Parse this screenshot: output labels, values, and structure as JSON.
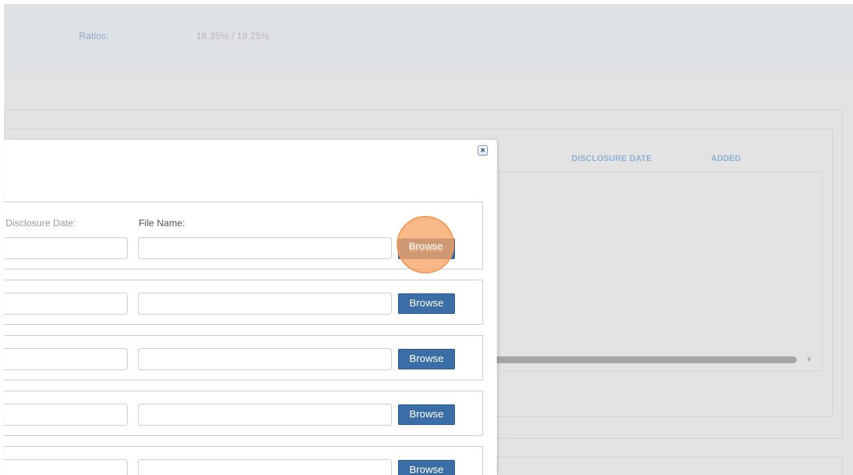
{
  "summary": {
    "ratios_label": "Ratios:",
    "ratios_value": "18.35% / 19.25%"
  },
  "grid": {
    "columns": [
      "DISCLOSURE DATE",
      "ADDED"
    ]
  },
  "dialog": {
    "close_icon": "close-icon",
    "disclosure_date_label": "Disclosure Date:",
    "file_name_label": "File Name:",
    "browse_label": "Browse",
    "rows": [
      {
        "disclosure_date": "",
        "file_name": ""
      },
      {
        "disclosure_date": "",
        "file_name": ""
      },
      {
        "disclosure_date": "",
        "file_name": ""
      },
      {
        "disclosure_date": "",
        "file_name": ""
      },
      {
        "disclosure_date": "",
        "file_name": ""
      }
    ]
  },
  "colors": {
    "accent_button": "#3b6ea6",
    "header_label": "#8eb0d6",
    "click_highlight": "#f7a465"
  }
}
